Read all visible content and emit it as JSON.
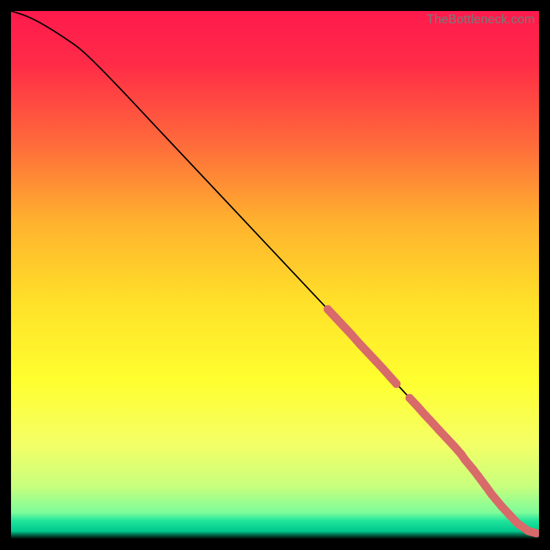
{
  "watermark": "TheBottleneck.com",
  "chart_data": {
    "type": "line",
    "title": "",
    "xlabel": "",
    "ylabel": "",
    "xlim": [
      0,
      100
    ],
    "ylim": [
      0,
      100
    ],
    "grid": false,
    "legend": false,
    "gradient_stops": [
      {
        "offset": 0.0,
        "color": "#ff1a4d"
      },
      {
        "offset": 0.1,
        "color": "#ff2b47"
      },
      {
        "offset": 0.25,
        "color": "#ff6a3b"
      },
      {
        "offset": 0.4,
        "color": "#ffb22e"
      },
      {
        "offset": 0.55,
        "color": "#ffe029"
      },
      {
        "offset": 0.7,
        "color": "#ffff2f"
      },
      {
        "offset": 0.82,
        "color": "#f4ff66"
      },
      {
        "offset": 0.9,
        "color": "#c8ff7d"
      },
      {
        "offset": 0.95,
        "color": "#7dfc9a"
      },
      {
        "offset": 0.965,
        "color": "#22e59b"
      },
      {
        "offset": 0.985,
        "color": "#00c98e"
      },
      {
        "offset": 1.0,
        "color": "#000000"
      }
    ],
    "series": [
      {
        "name": "bottleneck-curve",
        "x": [
          0,
          3,
          6,
          10,
          14,
          20,
          28,
          36,
          44,
          52,
          60,
          66,
          72,
          78,
          84,
          88,
          91,
          94,
          96.5,
          98.5,
          100
        ],
        "y": [
          100,
          99,
          97.5,
          95,
          92,
          86,
          77.5,
          69,
          60.5,
          52,
          43.5,
          37,
          30.5,
          24,
          17.5,
          12.5,
          8.5,
          5,
          2.5,
          1.2,
          1.1
        ]
      }
    ],
    "markers": {
      "name": "highlighted-segment",
      "color": "#d86a6a",
      "radius_px": 6,
      "points_xy": [
        [
          60.0,
          43.5
        ],
        [
          61.5,
          41.9
        ],
        [
          63.0,
          40.3
        ],
        [
          64.5,
          38.7
        ],
        [
          66.0,
          37.0
        ],
        [
          67.5,
          35.4
        ],
        [
          69.0,
          33.8
        ],
        [
          70.5,
          32.2
        ],
        [
          72.0,
          30.5
        ],
        [
          73.0,
          29.4
        ],
        [
          75.5,
          26.7
        ],
        [
          77.0,
          25.1
        ],
        [
          78.5,
          23.4
        ],
        [
          80.0,
          21.8
        ],
        [
          81.0,
          20.7
        ],
        [
          82.5,
          19.1
        ],
        [
          84.0,
          17.5
        ],
        [
          85.3,
          16.0
        ],
        [
          86.0,
          15.0
        ],
        [
          87.5,
          13.2
        ],
        [
          88.5,
          11.9
        ],
        [
          90.0,
          9.9
        ],
        [
          91.0,
          8.5
        ],
        [
          92.0,
          7.3
        ],
        [
          93.0,
          6.1
        ],
        [
          94.5,
          4.5
        ],
        [
          96.0,
          2.9
        ],
        [
          98.0,
          1.5
        ],
        [
          99.5,
          1.1
        ]
      ]
    }
  }
}
